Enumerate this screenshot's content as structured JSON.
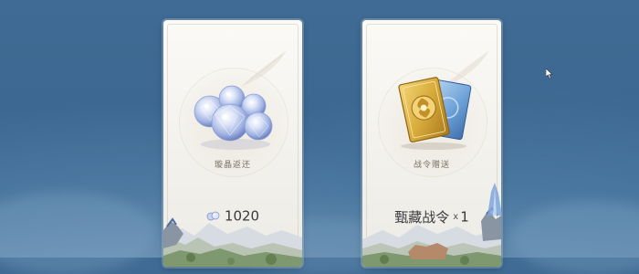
{
  "cards": [
    {
      "title": "璇晶返还",
      "value": "1020",
      "icon": "crystal-orbs-icon"
    },
    {
      "title": "战令赠送",
      "value_label": "甄藏战令",
      "multiplier_sign": "x",
      "quantity": "1",
      "icon": "battle-pass-cards-icon"
    }
  ],
  "colors": {
    "background": "#3f6b94",
    "card": "#f8f7f3",
    "title_text": "#7a7264",
    "value_text": "#3a3a3e",
    "crystal": "#b9c8ec",
    "gold_card": "#d8ac3c",
    "blue_card": "#6fa3d8"
  }
}
